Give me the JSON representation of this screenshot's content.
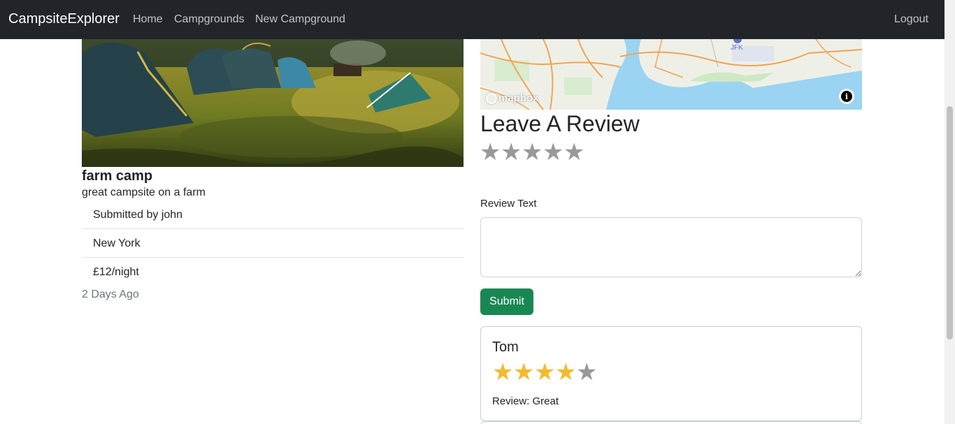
{
  "navbar": {
    "brand": "CampsiteExplorer",
    "links": [
      "Home",
      "Campgrounds",
      "New Campground"
    ],
    "logout": "Logout"
  },
  "campground": {
    "title": "farm camp",
    "description": "great campsite on a farm",
    "details": [
      "Submitted by john",
      "New York",
      "£12/night"
    ],
    "posted": "2 Days Ago"
  },
  "map": {
    "attribution_logo": "mapbox",
    "airport_label": "JFK",
    "info_icon": "info-icon"
  },
  "review_form": {
    "heading": "Leave A Review",
    "rating": 0,
    "max_rating": 5,
    "text_label": "Review Text",
    "text_value": "",
    "submit_label": "Submit"
  },
  "reviews": [
    {
      "author": "Tom",
      "rating": 4,
      "max_rating": 5,
      "text": "Review: Great"
    }
  ],
  "colors": {
    "navbar_bg": "#212529",
    "submit_green": "#198754",
    "star_filled": "#f3bb2c",
    "star_empty": "#999999"
  }
}
